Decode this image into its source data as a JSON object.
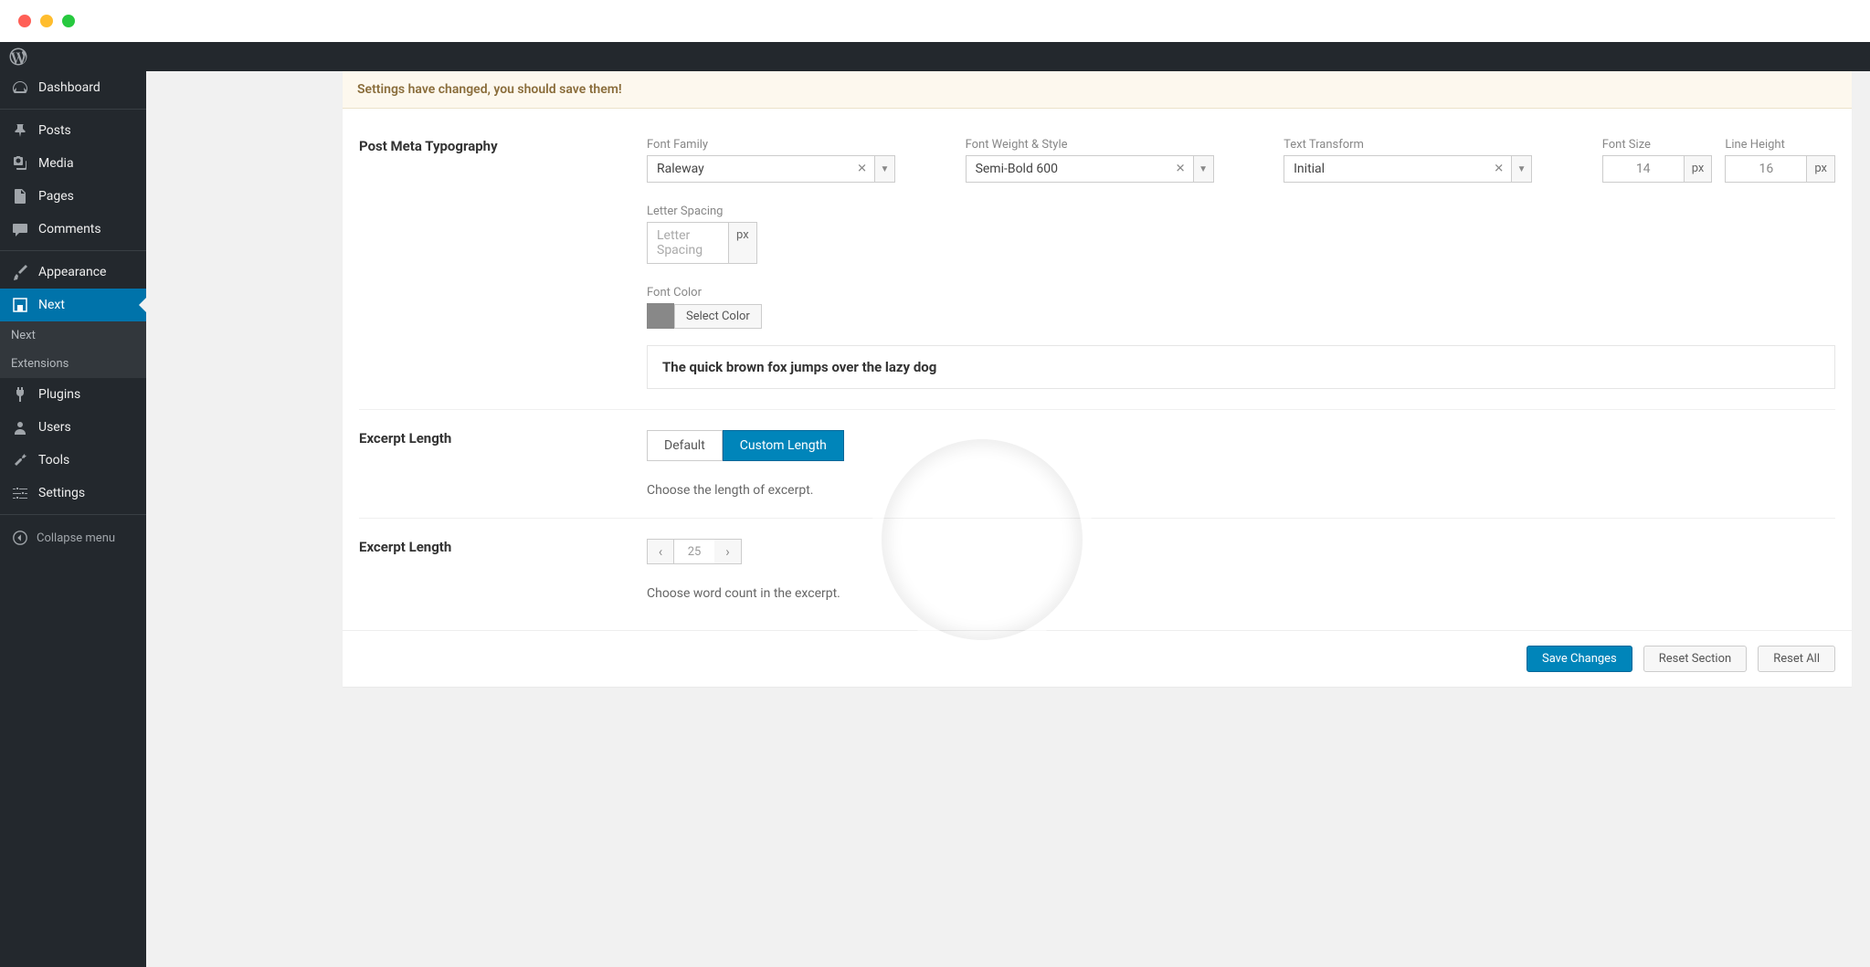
{
  "sidebar": {
    "items": [
      {
        "label": "Dashboard",
        "icon": "dashboard"
      },
      {
        "label": "Posts",
        "icon": "pin"
      },
      {
        "label": "Media",
        "icon": "media"
      },
      {
        "label": "Pages",
        "icon": "pages"
      },
      {
        "label": "Comments",
        "icon": "comment"
      },
      {
        "label": "Appearance",
        "icon": "brush"
      },
      {
        "label": "Next",
        "icon": "next-theme",
        "current": true
      },
      {
        "label": "Plugins",
        "icon": "plug"
      },
      {
        "label": "Users",
        "icon": "users"
      },
      {
        "label": "Tools",
        "icon": "wrench"
      },
      {
        "label": "Settings",
        "icon": "settings"
      }
    ],
    "submenu": [
      "Next",
      "Extensions"
    ],
    "collapse": "Collapse menu"
  },
  "notice": "Settings have changed, you should save them!",
  "section1": {
    "title": "Post Meta Typography",
    "font_family": {
      "label": "Font Family",
      "value": "Raleway"
    },
    "font_weight": {
      "label": "Font Weight & Style",
      "value": "Semi-Bold 600"
    },
    "text_transform": {
      "label": "Text Transform",
      "value": "Initial"
    },
    "font_size": {
      "label": "Font Size",
      "value": "14",
      "unit": "px"
    },
    "line_height": {
      "label": "Line Height",
      "value": "16",
      "unit": "px"
    },
    "letter_spacing": {
      "label": "Letter Spacing",
      "placeholder": "Letter Spacing",
      "unit": "px"
    },
    "font_color": {
      "label": "Font Color",
      "button": "Select Color",
      "swatch": "#888888"
    },
    "preview": "The quick brown fox jumps over the lazy dog"
  },
  "section2": {
    "title": "Excerpt Length",
    "options": [
      "Default",
      "Custom Length"
    ],
    "selected": 1,
    "help": "Choose the length of excerpt."
  },
  "section3": {
    "title": "Excerpt Length",
    "value": "25",
    "help": "Choose word count in the excerpt."
  },
  "footer": {
    "save": "Save Changes",
    "reset_section": "Reset Section",
    "reset_all": "Reset All"
  }
}
